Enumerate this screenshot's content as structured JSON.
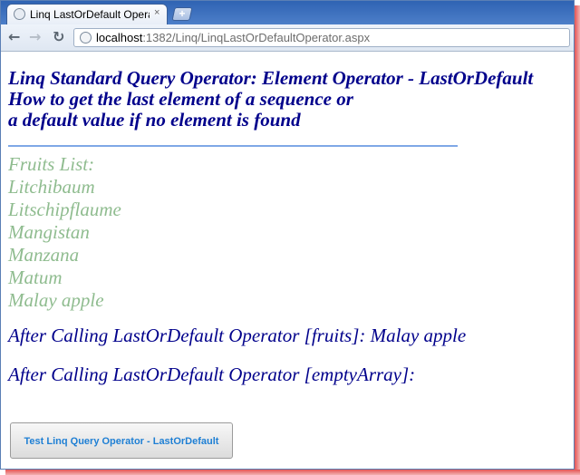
{
  "browser": {
    "tab_title": "Linq LastOrDefault Operato",
    "tab_close": "×",
    "new_tab": "+",
    "url_host": "localhost",
    "url_path": ":1382/Linq/LinqLastOrDefaultOperator.aspx",
    "icons": {
      "tab_favicon": "page-icon",
      "tab_close": "close-icon",
      "back": "back-arrow-icon",
      "forward": "forward-arrow-icon",
      "reload": "reload-icon",
      "page": "page-icon"
    }
  },
  "page": {
    "heading_lines": [
      "Linq Standard Query Operator: Element Operator - LastOrDefault",
      "How to get the last element of a sequence or",
      "a default value if no element is found"
    ],
    "fruits_label": "Fruits List:",
    "fruits": [
      "Litchibaum",
      "Litschipflaume",
      "Mangistan",
      "Manzana",
      "Matum",
      "Malay apple"
    ],
    "result_fruits": "After Calling LastOrDefault Operator [fruits]: Malay apple",
    "result_empty": "After Calling LastOrDefault Operator [emptyArray]:",
    "button_label": "Test Linq Query Operator - LastOrDefault"
  },
  "colors": {
    "heading": "#00008b",
    "fruits": "#8fbc8f",
    "divider": "#7fa8e6",
    "button_text": "#1e7fd4"
  }
}
